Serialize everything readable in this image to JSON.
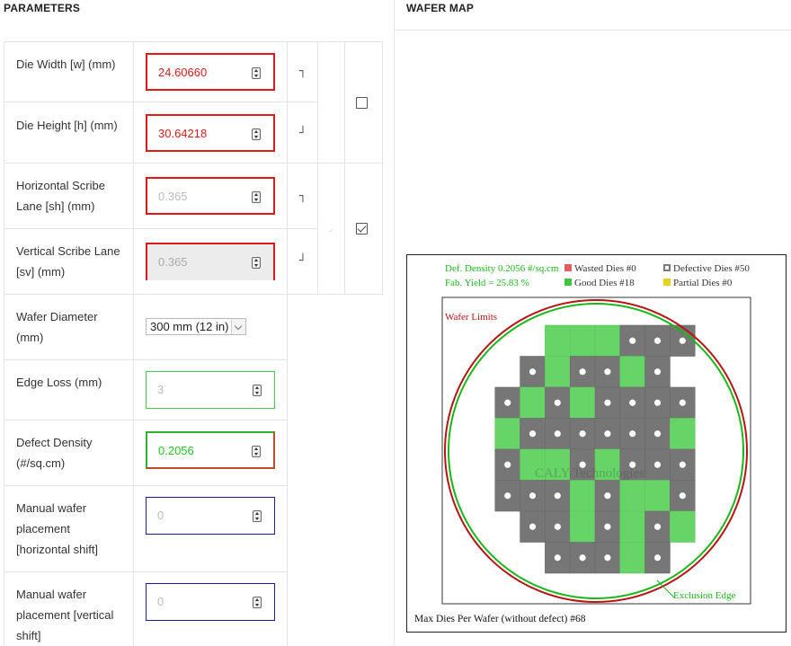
{
  "sections": {
    "parameters": "PARAMETERS",
    "wafer_map": "WAFER MAP"
  },
  "fields": [
    {
      "key": "die_width",
      "label": "Die Width [w] (mm)",
      "value": "24.60660",
      "state": "error"
    },
    {
      "key": "die_height",
      "label": "Die Height [h] (mm)",
      "value": "30.64218",
      "state": "error"
    },
    {
      "key": "h_scribe",
      "label_lines": [
        "Horizontal Scribe",
        "Lane [sh] (mm)"
      ],
      "placeholder": "0.365",
      "state": "error"
    },
    {
      "key": "v_scribe",
      "label_lines": [
        "Vertical Scribe Lane",
        "[sv] (mm)"
      ],
      "placeholder": "0.365",
      "state": "error-disabled"
    },
    {
      "key": "wafer_diameter",
      "label_lines": [
        "Wafer Diameter",
        "(mm)"
      ],
      "selected": "300 mm (12 in)"
    },
    {
      "key": "edge_loss",
      "label": "Edge Loss (mm)",
      "placeholder": "3",
      "state": "ok"
    },
    {
      "key": "defect_density",
      "label_lines": [
        "Defect Density",
        "(#/sq.cm)"
      ],
      "value": "0.2056",
      "state": "ok"
    },
    {
      "key": "h_shift",
      "label_lines": [
        "Manual wafer",
        "placement",
        "[horizontal shift]"
      ],
      "placeholder": "0",
      "state": "focus"
    },
    {
      "key": "v_shift",
      "label_lines": [
        "Manual wafer",
        "placement [vertical",
        "shift]"
      ],
      "placeholder": "0",
      "state": "focus"
    }
  ],
  "links": {
    "die_size_linked": false,
    "scribe_linked": true
  },
  "wafer_map": {
    "def_density": "Def. Density 0.2056 #/sq.cm",
    "fab_yield": "Fab. Yield = 25.83 %",
    "legend": [
      {
        "label": "Wasted Dies  #0",
        "color": "#e06060"
      },
      {
        "label": "Defective Dies  #50",
        "color": "#7a7a7a"
      },
      {
        "label": "Good Dies #18",
        "color": "#66d466"
      },
      {
        "label": "Partial Dies #0",
        "color": "#e8d020"
      }
    ],
    "wafer_limits_label": "Wafer Limits",
    "exclusion_edge_label": "Exclusion Edge",
    "watermark": "CALY Technologies",
    "footer": "Max Dies Per Wafer (without defect) #68",
    "colors": {
      "limit": "#b81414",
      "exclusion": "#18b818",
      "good": "#66d466",
      "defective": "#767676",
      "frame": "#333333"
    },
    "rows": [
      "...GGGDDD...",
      "..DGDDGD....",
      ".DGDGDDDD...",
      ".GDDDDDDG...",
      ".DGGDGDDD...",
      ".DDDGDGGD...",
      "..DDGDGDG...",
      "...DDDGD...."
    ]
  }
}
